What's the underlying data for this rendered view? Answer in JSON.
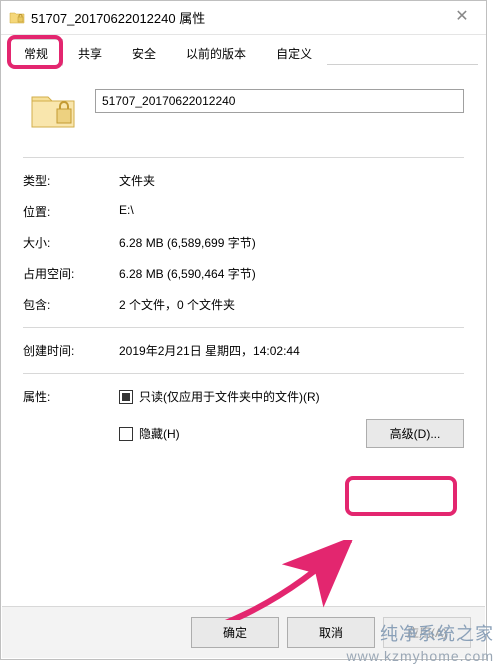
{
  "titlebar": {
    "title": "51707_20170622012240 属性"
  },
  "tabs": {
    "general": "常规",
    "share": "共享",
    "security": "安全",
    "previous": "以前的版本",
    "custom": "自定义"
  },
  "folder_name": "51707_20170622012240",
  "rows": {
    "type_label": "类型:",
    "type_value": "文件夹",
    "location_label": "位置:",
    "location_value": "E:\\",
    "size_label": "大小:",
    "size_value": "6.28 MB (6,589,699 字节)",
    "disk_label": "占用空间:",
    "disk_value": "6.28 MB (6,590,464 字节)",
    "contains_label": "包含:",
    "contains_value": "2 个文件，0 个文件夹",
    "created_label": "创建时间:",
    "created_value": "2019年2月21日 星期四，14:02:44",
    "attr_label": "属性:",
    "readonly_label": "只读(仅应用于文件夹中的文件)(R)",
    "hidden_label": "隐藏(H)",
    "advanced_btn": "高级(D)..."
  },
  "buttons": {
    "ok": "确定",
    "cancel": "取消",
    "apply": "应用(A)"
  },
  "watermark": {
    "line1": "纯净系统之家",
    "line2": "www.kzmyhome.com"
  }
}
